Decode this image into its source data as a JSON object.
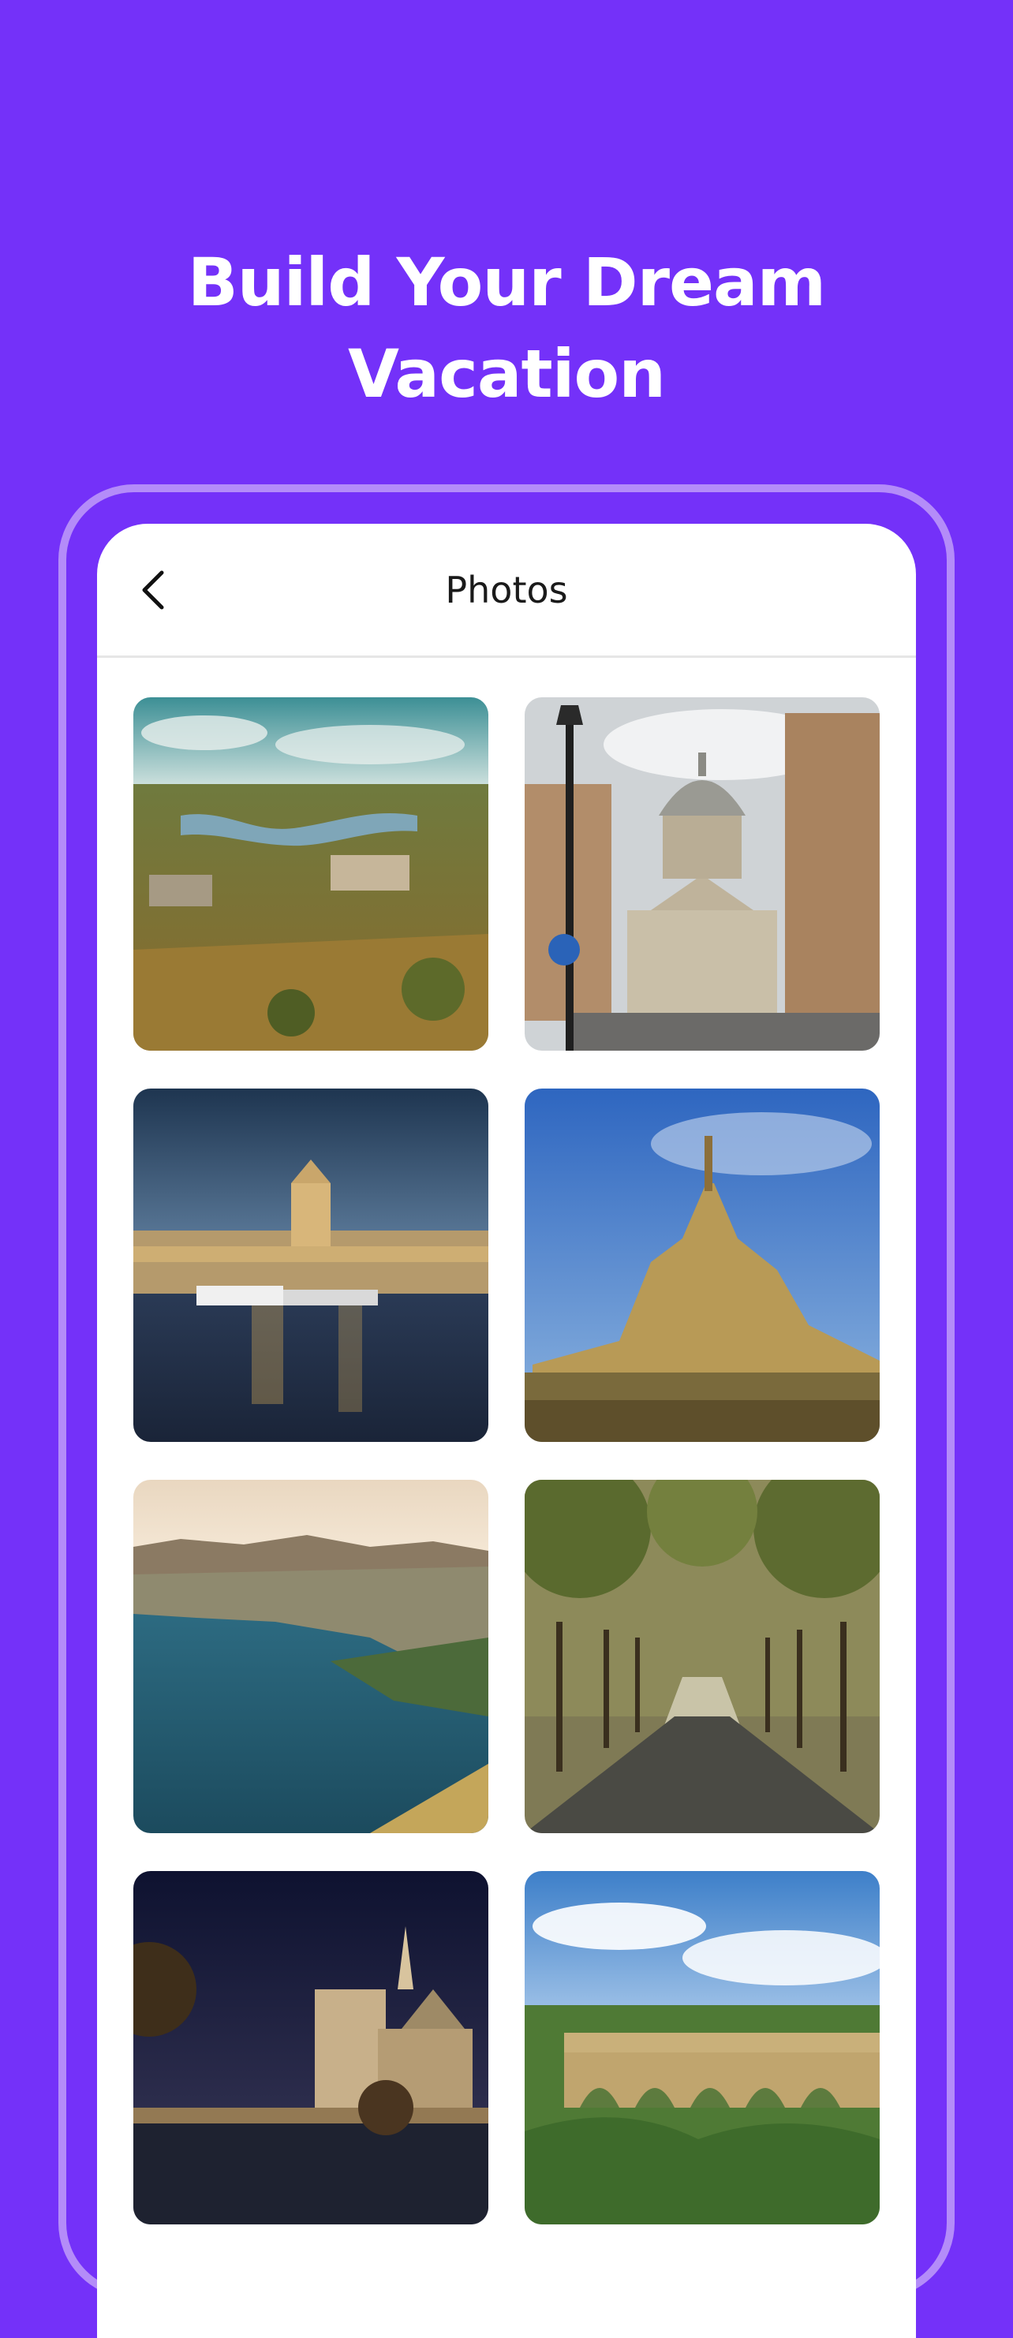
{
  "hero": {
    "line1": "Build Your Dream",
    "line2": "Vacation"
  },
  "screen": {
    "title": "Photos",
    "back_icon": "chevron-left-icon"
  },
  "photos": [
    {
      "subject": "river valley with castle ruins"
    },
    {
      "subject": "street leading to domed Panthéon"
    },
    {
      "subject": "harbor at night with boats"
    },
    {
      "subject": "Mont-Saint-Michel abbey"
    },
    {
      "subject": "coastal town by the sea"
    },
    {
      "subject": "tree-lined avenue"
    },
    {
      "subject": "cathedral by the river at night"
    },
    {
      "subject": "stone aqueduct over greenery"
    }
  ],
  "colors": {
    "background": "#7431f9",
    "frame": "#b48cf9",
    "screen": "#ffffff"
  }
}
